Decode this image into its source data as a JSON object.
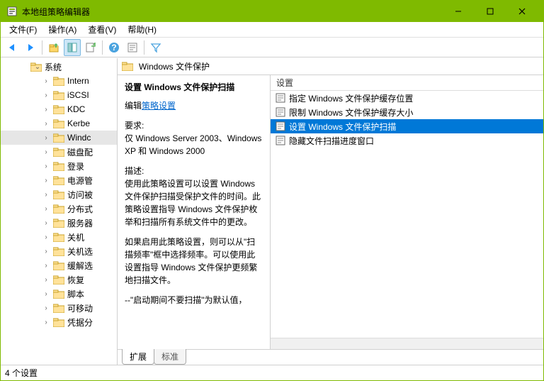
{
  "window": {
    "title": "本地组策略编辑器"
  },
  "menu": {
    "file": "文件(F)",
    "action": "操作(A)",
    "view": "查看(V)",
    "help": "帮助(H)"
  },
  "tree": {
    "top": "系统",
    "items": [
      "Intern",
      "iSCSI",
      "KDC",
      "Kerbe",
      "Windc",
      "磁盘配",
      "登录",
      "电源管",
      "访问被",
      "分布式",
      "服务器",
      "关机",
      "关机选",
      "缓解选",
      "恢复",
      "脚本",
      "可移动",
      "凭据分"
    ],
    "selected_index": 4
  },
  "header": {
    "title": "Windows 文件保护"
  },
  "desc": {
    "title": "设置 Windows 文件保护扫描",
    "edit_prefix": "编辑",
    "edit_link": "策略设置",
    "req_label": "要求:",
    "req_text": "仅 Windows Server 2003、Windows XP 和 Windows 2000",
    "desc_label": "描述:",
    "desc_text": "使用此策略设置可以设置 Windows 文件保护扫描受保护文件的时间。此策略设置指导 Windows 文件保护枚举和扫描所有系统文件中的更改。",
    "para2": "如果启用此策略设置，则可以从\"扫描频率\"框中选择频率。可以使用此设置指导 Windows 文件保护更频繁地扫描文件。",
    "para3": "--\"启动期间不要扫描\"为默认值，"
  },
  "list": {
    "header": "设置",
    "items": [
      "指定 Windows 文件保护缓存位置",
      "限制 Windows 文件保护缓存大小",
      "设置 Windows 文件保护扫描",
      "隐藏文件扫描进度窗口"
    ],
    "selected_index": 2
  },
  "tabs": {
    "extended": "扩展",
    "standard": "标准"
  },
  "status": {
    "text": "4 个设置"
  }
}
